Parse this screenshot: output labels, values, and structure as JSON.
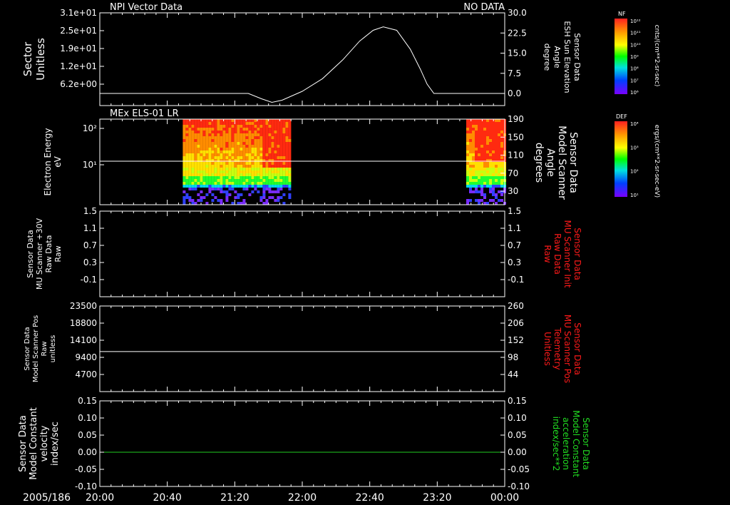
{
  "date_label": "2005/186",
  "time_ticks": [
    "20:00",
    "20:40",
    "21:20",
    "22:00",
    "22:40",
    "23:20",
    "00:00"
  ],
  "colors": {
    "frame": "#ffffff",
    "red_label": "#ff1a1a",
    "green_label": "#22dd22",
    "trace": "#ffffff",
    "zero_line": "#22cc22"
  },
  "chart_data": [
    {
      "type": "line",
      "title": "NPI Vector Data",
      "status": "NO DATA",
      "ylabel": [
        "Sector",
        "Unitless"
      ],
      "left_ticks": [
        "3.1e+01",
        "2.5e+01",
        "1.9e+01",
        "1.2e+01",
        "6.2e+00"
      ],
      "right_ticks": [
        "30.0",
        "22.5",
        "15.0",
        "7.5",
        "0.0"
      ],
      "right_label": [
        "Sensor Data",
        "ESH Sun Elevation",
        "Angle",
        "degree"
      ],
      "right_ylim": [
        -4.5,
        30
      ],
      "series": [
        {
          "x_hours": [
            0.0,
            2.2,
            2.4,
            2.55,
            2.7,
            3.0,
            3.3,
            3.6,
            3.85,
            4.05,
            4.2,
            4.4,
            4.6,
            4.75,
            4.85,
            4.95,
            5.2,
            6.0
          ],
          "y": [
            0.0,
            0.0,
            -2.0,
            -3.3,
            -2.5,
            0.8,
            5.5,
            12.5,
            19.5,
            23.5,
            24.8,
            23.5,
            16.5,
            9.0,
            3.5,
            0.0,
            0.0,
            0.0
          ]
        }
      ],
      "colorbar": {
        "label": "NF",
        "units": "cnts/(cm**2-sr-sec)",
        "ticks": [
          "10¹²",
          "10¹¹",
          "10¹⁰",
          "10⁹",
          "10⁸",
          "10⁷",
          "10⁶"
        ]
      }
    },
    {
      "type": "heatmap",
      "title": "MEx ELS-01 LR",
      "ylabel": [
        "Electron Energy",
        "eV"
      ],
      "left_ticks": [
        "10²",
        "10¹"
      ],
      "right_ticks": [
        "190",
        "150",
        "110",
        "70",
        "30"
      ],
      "right_label": [
        "Sensor Data",
        "Model Scanner",
        "Angle",
        "degrees"
      ],
      "right_ylim": [
        0,
        190
      ],
      "overlay_line_y_deg": 100,
      "data_segments_hours": [
        [
          1.23,
          2.83
        ],
        [
          5.43,
          6.0
        ]
      ],
      "colorbar": {
        "label": "DEF",
        "units": "ergs/(cm**2-sr-sec-eV)",
        "ticks": [
          "10⁴",
          "10³",
          "10²",
          "10¹"
        ]
      }
    },
    {
      "type": "line",
      "ylabel": [
        "Sensor Data",
        "MU Scanner +30V",
        "Raw Data",
        "Raw"
      ],
      "left_ticks": [
        "1.5",
        "1.1",
        "0.7",
        "0.3",
        "-0.1"
      ],
      "right_ticks": [
        "1.5",
        "1.1",
        "0.7",
        "0.3",
        "-0.1"
      ],
      "right_label": [
        "Sensor Data",
        "MU Scanner Init",
        "Raw Data",
        "Raw"
      ],
      "series": []
    },
    {
      "type": "line",
      "ylabel": [
        "Sensor Data",
        "Model Scanner Pos",
        "Raw",
        "unitless"
      ],
      "left_ticks": [
        "23500",
        "18800",
        "14100",
        "9400",
        "4700"
      ],
      "right_ticks": [
        "260",
        "206",
        "152",
        "98",
        "44"
      ],
      "right_label": [
        "Sensor Data",
        "MU Scanner Pos",
        "Telemetry",
        "Unitless"
      ],
      "left_ylim": [
        0,
        23500
      ],
      "series": [
        {
          "x_hours": [
            0,
            6
          ],
          "y": [
            11000,
            11000
          ]
        }
      ]
    },
    {
      "type": "line",
      "ylabel": [
        "Sensor Data",
        "Model Constant",
        "velocity",
        "index/sec"
      ],
      "left_ticks": [
        "0.15",
        "0.10",
        "0.05",
        "0.00",
        "-0.05",
        "-0.10"
      ],
      "right_ticks": [
        "0.15",
        "0.10",
        "0.05",
        "0.00",
        "-0.05",
        "-0.10"
      ],
      "right_label": [
        "Sensor Data",
        "Model Constant",
        "acceleration",
        "index/sec**2"
      ],
      "ylim": [
        -0.1,
        0.15
      ],
      "series": [
        {
          "x_hours": [
            0,
            6
          ],
          "y": [
            0,
            0
          ]
        }
      ]
    }
  ]
}
